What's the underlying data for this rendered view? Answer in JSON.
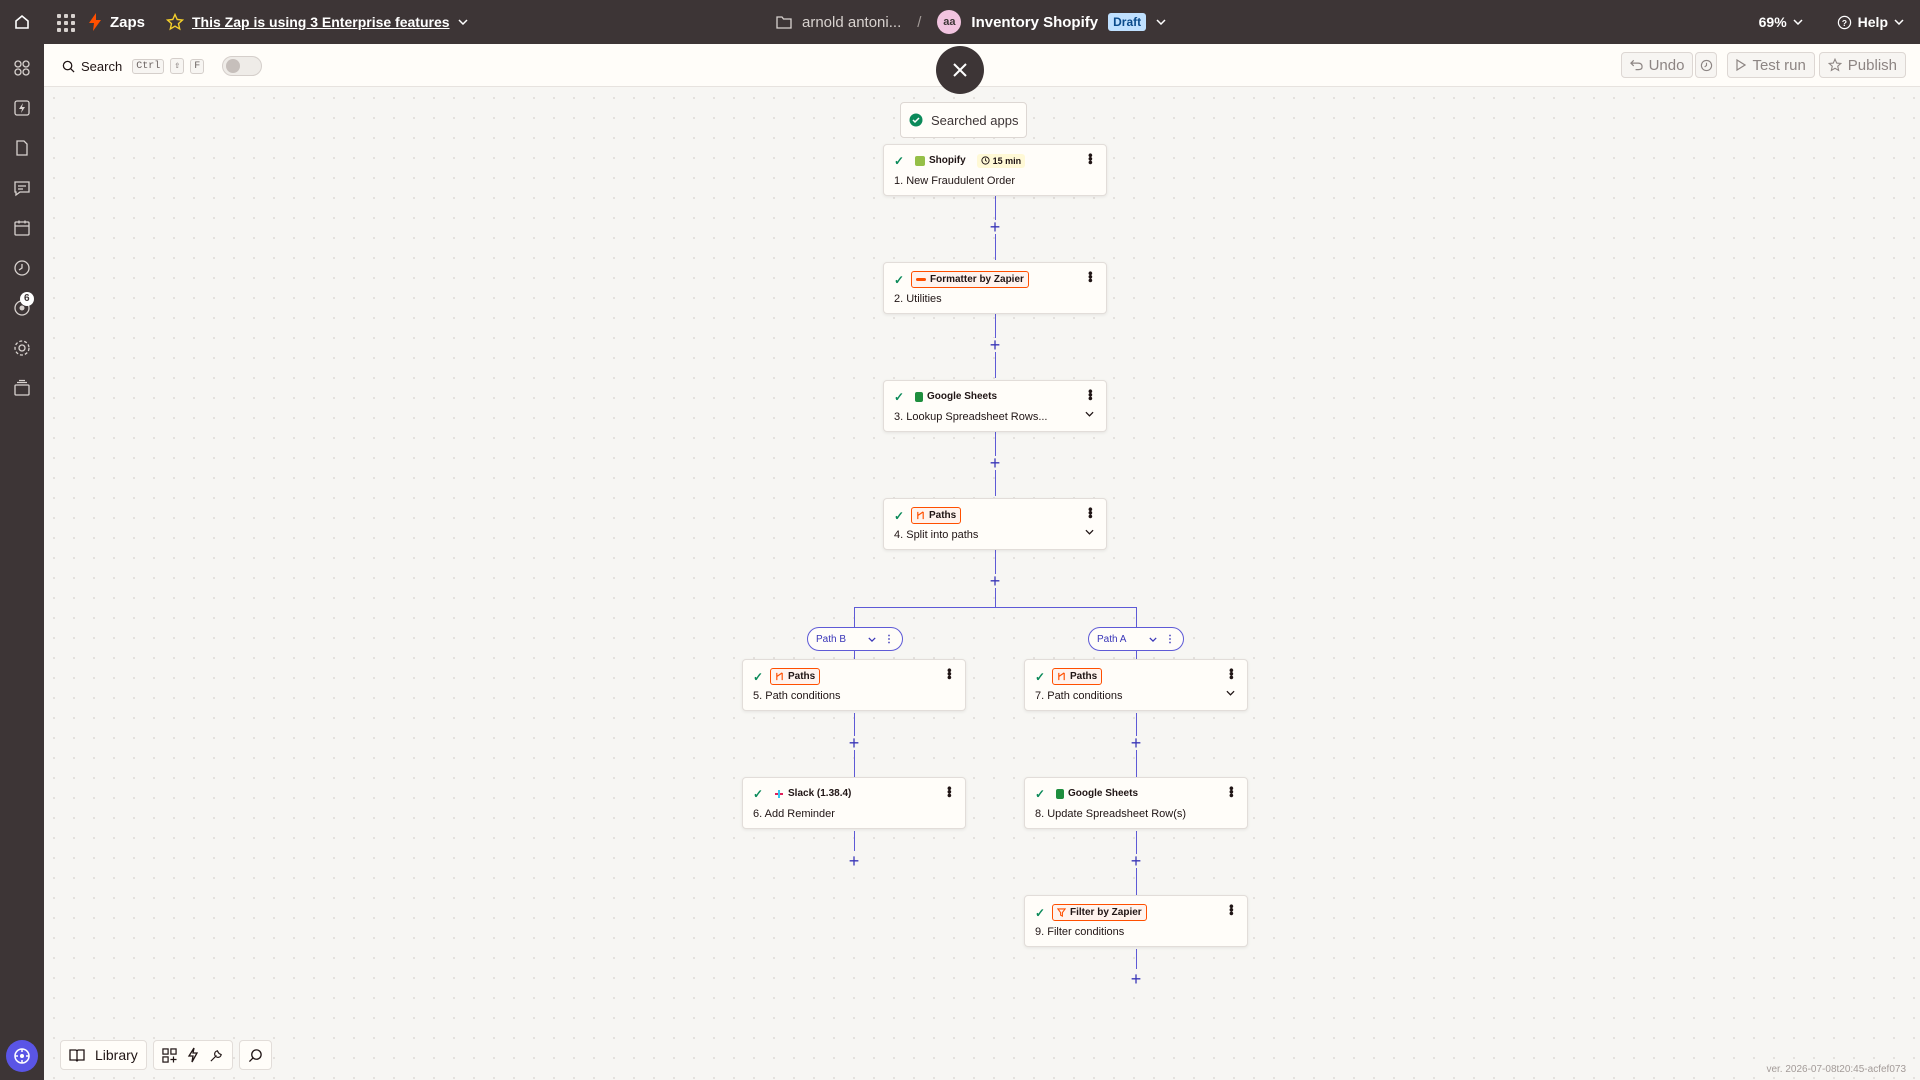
{
  "header": {
    "app_name": "Zaps",
    "enterprise_notice": "This Zap is using 3 Enterprise features",
    "folder": "arnold antoni...",
    "separator": "/",
    "avatar_initials": "aa",
    "zap_name": "Inventory Shopify",
    "status_badge": "Draft",
    "zoom": "69%",
    "help": "Help"
  },
  "sidebar": {
    "notification_count": "6",
    "icons": [
      "home-icon",
      "apps-icon",
      "zaps-icon",
      "tables-icon",
      "interfaces-icon",
      "calendar-icon",
      "history-icon",
      "agents-icon",
      "settings-icon",
      "canvas-icon",
      "ai-assistant-icon"
    ]
  },
  "toolbar": {
    "search_label": "Search",
    "shortcut_keys": [
      "Ctrl",
      "⇧",
      "F"
    ],
    "undo_label": "Undo",
    "test_run_label": "Test run",
    "publish_label": "Publish"
  },
  "canvas": {
    "searched_apps_label": "Searched apps",
    "steps": [
      {
        "app": "Shopify",
        "title": "1. New Fraudulent Order",
        "timer": "15 min",
        "has_chevron": false
      },
      {
        "app": "Formatter by Zapier",
        "title": "2. Utilities",
        "has_chevron": false
      },
      {
        "app": "Google Sheets",
        "title": "3. Lookup Spreadsheet Rows...",
        "has_chevron": true
      },
      {
        "app": "Paths",
        "title": "4. Split into paths",
        "has_chevron": true
      },
      {
        "app": "Paths",
        "title": "5. Path conditions",
        "has_chevron": false
      },
      {
        "app": "Slack (1.38.4)",
        "title": "6. Add Reminder",
        "has_chevron": false
      },
      {
        "app": "Paths",
        "title": "7. Path conditions",
        "has_chevron": true
      },
      {
        "app": "Google Sheets",
        "title": "8. Update Spreadsheet Row(s)",
        "has_chevron": false
      },
      {
        "app": "Filter by Zapier",
        "title": "9. Filter conditions",
        "has_chevron": false
      }
    ],
    "paths": [
      {
        "label": "Path B"
      },
      {
        "label": "Path A"
      }
    ]
  },
  "dock": {
    "library_label": "Library"
  },
  "version": "ver. 2026-07-08t20:45-acfef073",
  "colors": {
    "header_bg": "#3d3536",
    "accent_orange": "#ff4f00",
    "connector_purple": "#5e5ad6",
    "check_green": "#0b8a5a",
    "draft_bg": "#bfe0ff"
  }
}
